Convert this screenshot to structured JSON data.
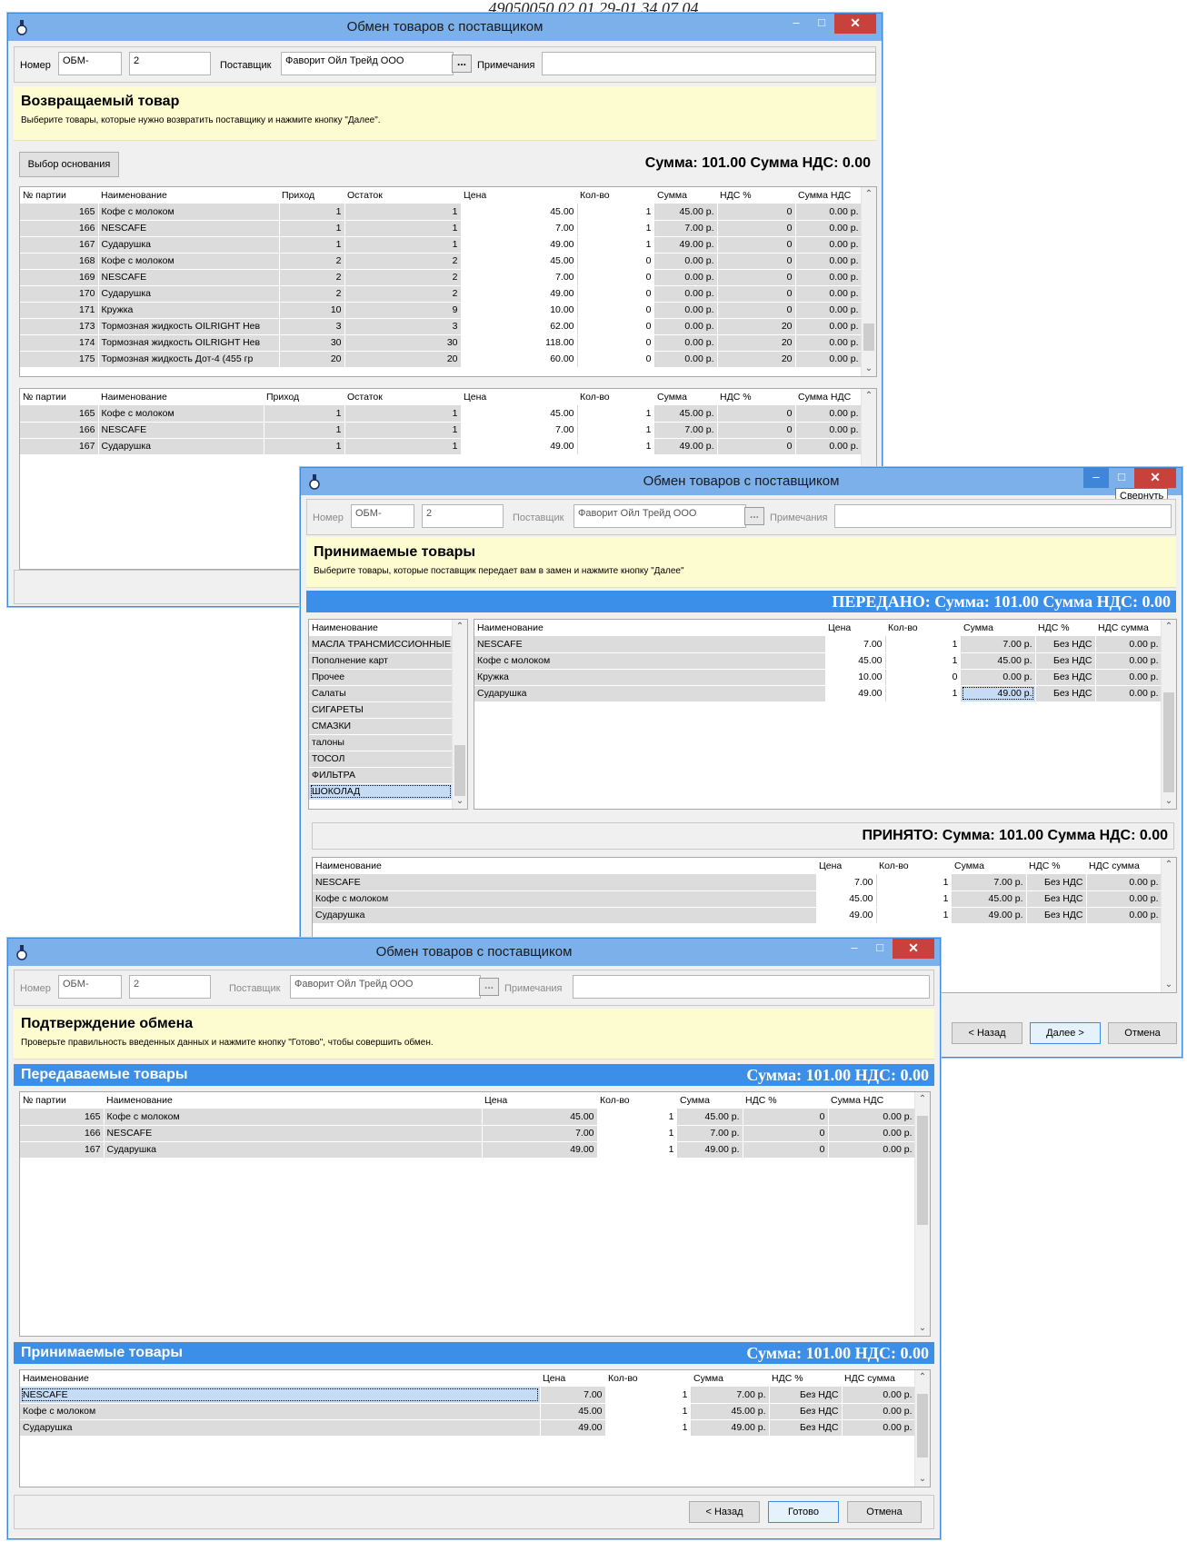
{
  "doc_header": "49050050.02.01.29-01 34 07 04",
  "window_title": "Обмен товаров с поставщиком",
  "minimize_tooltip": "Свернуть",
  "labels": {
    "number": "Номер",
    "supplier": "Поставщик",
    "notes": "Примечания",
    "dots": "..."
  },
  "values": {
    "number_prefix": "ОБМ-",
    "number": "2",
    "supplier": "Фаворит Ойл Трейд ООО",
    "notes": ""
  },
  "win1": {
    "heading": "Возвращаемый товар",
    "subheading": "Выберите товары, которые нужно возвратить поставщику и нажмите кнопку \"Далее\".",
    "basis_button": "Выбор основания",
    "totals": "Сумма: 101.00  Сумма НДС: 0.00",
    "columns": [
      "№ партии",
      "Наименование",
      "Приход",
      "Остаток",
      "Цена",
      "Кол-во",
      "Сумма",
      "НДС %",
      "Сумма НДС"
    ],
    "rows": [
      [
        "165",
        "Кофе с молоком",
        "1",
        "1",
        "45.00",
        "1",
        "45.00 р.",
        "0",
        "0.00 р."
      ],
      [
        "166",
        "NESCAFE",
        "1",
        "1",
        "7.00",
        "1",
        "7.00 р.",
        "0",
        "0.00 р."
      ],
      [
        "167",
        "Сударушка",
        "1",
        "1",
        "49.00",
        "1",
        "49.00 р.",
        "0",
        "0.00 р."
      ],
      [
        "168",
        "Кофе с молоком",
        "2",
        "2",
        "45.00",
        "0",
        "0.00 р.",
        "0",
        "0.00 р."
      ],
      [
        "169",
        "NESCAFE",
        "2",
        "2",
        "7.00",
        "0",
        "0.00 р.",
        "0",
        "0.00 р."
      ],
      [
        "170",
        "Сударушка",
        "2",
        "2",
        "49.00",
        "0",
        "0.00 р.",
        "0",
        "0.00 р."
      ],
      [
        "171",
        "Кружка",
        "10",
        "9",
        "10.00",
        "0",
        "0.00 р.",
        "0",
        "0.00 р."
      ],
      [
        "173",
        "Тормозная жидкость OILRIGHT Нев",
        "3",
        "3",
        "62.00",
        "0",
        "0.00 р.",
        "20",
        "0.00 р."
      ],
      [
        "174",
        "Тормозная жидкость OILRIGHT Нев",
        "30",
        "30",
        "118.00",
        "0",
        "0.00 р.",
        "20",
        "0.00 р."
      ],
      [
        "175",
        "Тормозная жидкость Дот-4 (455 гр",
        "20",
        "20",
        "60.00",
        "0",
        "0.00 р.",
        "20",
        "0.00 р."
      ]
    ],
    "selected_rows": [
      [
        "165",
        "Кофе с молоком",
        "1",
        "1",
        "45.00",
        "1",
        "45.00 р.",
        "0",
        "0.00 р."
      ],
      [
        "166",
        "NESCAFE",
        "1",
        "1",
        "7.00",
        "1",
        "7.00 р.",
        "0",
        "0.00 р."
      ],
      [
        "167",
        "Сударушка",
        "1",
        "1",
        "49.00",
        "1",
        "49.00 р.",
        "0",
        "0.00 р."
      ]
    ]
  },
  "win2": {
    "heading": "Принимаемые товары",
    "subheading": "Выберите товары, которые поставщик передает вам в замен и нажмите кнопку \"Далее\"",
    "given_totals": "ПЕРЕДАНО:  Сумма: 101.00  Сумма НДС: 0.00",
    "received_totals": "ПРИНЯТО:  Сумма: 101.00  Сумма НДС: 0.00",
    "category_header": "Наименование",
    "categories": [
      "МАСЛА ТРАНСМИССИОННЫЕ",
      "Пополнение карт",
      "Прочее",
      "Салаты",
      "СИГАРЕТЫ",
      "СМАЗКИ",
      "талоны",
      "ТОСОЛ",
      "ФИЛЬТРА",
      "ШОКОЛАД"
    ],
    "selected_category": "ШОКОЛАД",
    "columns": [
      "Наименование",
      "Цена",
      "Кол-во",
      "Сумма",
      "НДС %",
      "НДС сумма"
    ],
    "products": [
      [
        "NESCAFE",
        "7.00",
        "1",
        "7.00 р.",
        "Без НДС",
        "0.00 р."
      ],
      [
        "Кофе с молоком",
        "45.00",
        "1",
        "45.00 р.",
        "Без НДС",
        "0.00 р."
      ],
      [
        "Кружка",
        "10.00",
        "0",
        "0.00 р.",
        "Без НДС",
        "0.00 р."
      ],
      [
        "Сударушка",
        "49.00",
        "1",
        "49.00 р.",
        "Без НДС",
        "0.00 р."
      ]
    ],
    "received": [
      [
        "NESCAFE",
        "7.00",
        "1",
        "7.00 р.",
        "Без НДС",
        "0.00 р."
      ],
      [
        "Кофе с молоком",
        "45.00",
        "1",
        "45.00 р.",
        "Без НДС",
        "0.00 р."
      ],
      [
        "Сударушка",
        "49.00",
        "1",
        "49.00 р.",
        "Без НДС",
        "0.00 р."
      ]
    ],
    "back": "< Назад",
    "next": "Далее >",
    "cancel": "Отмена"
  },
  "win3": {
    "heading": "Подтверждение обмена",
    "subheading": "Проверьте правильность введенных данных и нажмите кнопку \"Готово\", чтобы совершить обмен.",
    "given_label": "Передаваемые товары",
    "given_totals": "Сумма: 101.00  НДС: 0.00",
    "received_label": "Принимаемые товары",
    "received_totals": "Сумма: 101.00  НДС: 0.00",
    "given_columns": [
      "№ партии",
      "Наименование",
      "Цена",
      "Кол-во",
      "Сумма",
      "НДС %",
      "Сумма НДС"
    ],
    "given_rows": [
      [
        "165",
        "Кофе с молоком",
        "45.00",
        "1",
        "45.00 р.",
        "0",
        "0.00 р."
      ],
      [
        "166",
        "NESCAFE",
        "7.00",
        "1",
        "7.00 р.",
        "0",
        "0.00 р."
      ],
      [
        "167",
        "Сударушка",
        "49.00",
        "1",
        "49.00 р.",
        "0",
        "0.00 р."
      ]
    ],
    "received_columns": [
      "Наименование",
      "Цена",
      "Кол-во",
      "Сумма",
      "НДС %",
      "НДС сумма"
    ],
    "received_rows": [
      [
        "NESCAFE",
        "7.00",
        "1",
        "7.00 р.",
        "Без НДС",
        "0.00 р."
      ],
      [
        "Кофе с молоком",
        "45.00",
        "1",
        "45.00 р.",
        "Без НДС",
        "0.00 р."
      ],
      [
        "Сударушка",
        "49.00",
        "1",
        "49.00 р.",
        "Без НДС",
        "0.00 р."
      ]
    ],
    "back": "< Назад",
    "done": "Готово",
    "cancel": "Отмена"
  },
  "colors": {
    "titlebar": "#7cb0ea",
    "accent_blue": "#3c8fe8",
    "close_red": "#c9413d",
    "info_yellow": "#fdfbd0",
    "row_gray": "#dcdcdc"
  }
}
